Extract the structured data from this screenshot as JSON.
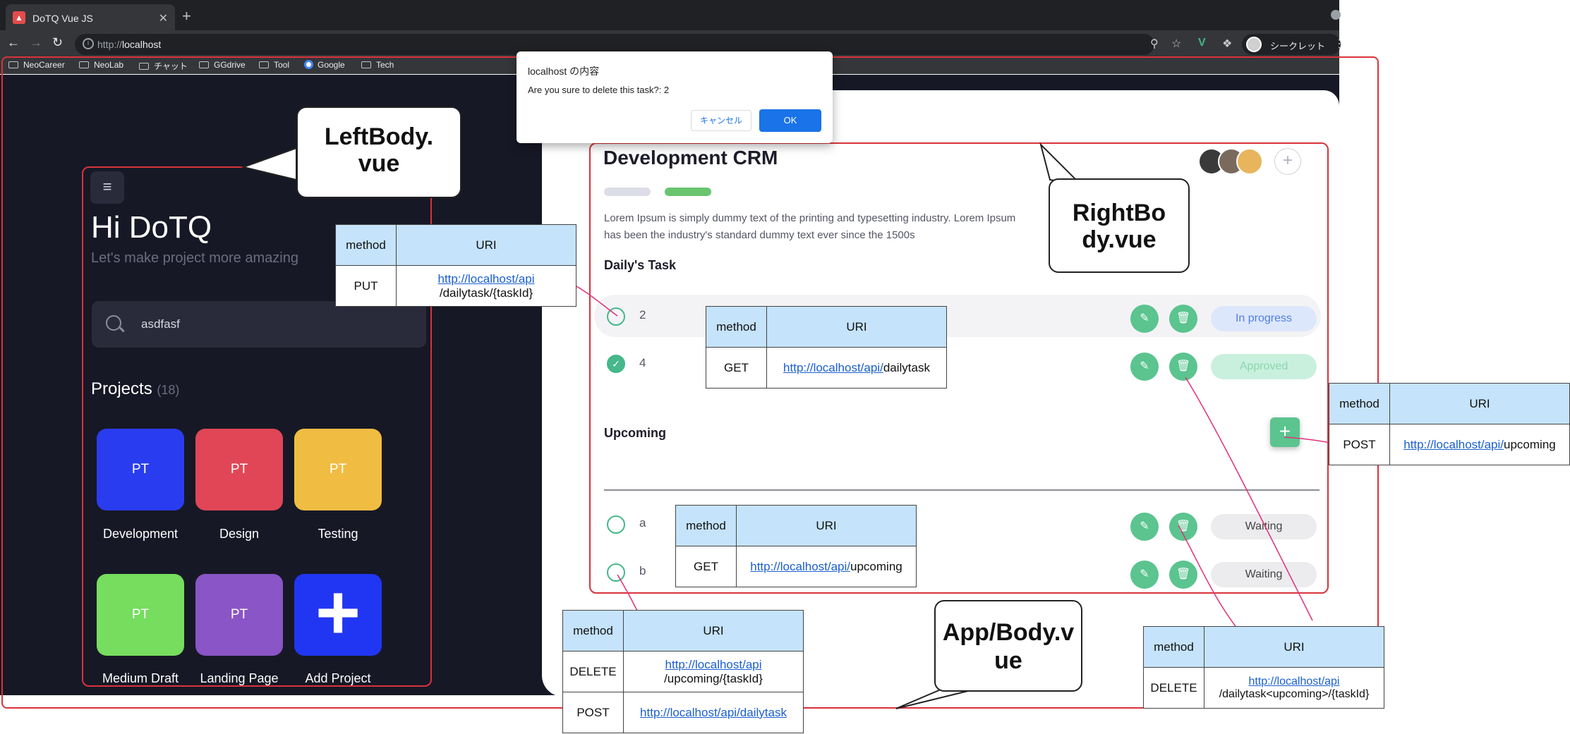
{
  "browser": {
    "tab_title": "DoTQ Vue JS",
    "tab_favicon": "▲",
    "tab_close": "✕",
    "new_tab": "+",
    "url_prefix": "http://",
    "url_host": "localhost",
    "incognito_label": "シークレット",
    "bookmarks": [
      "NeoCareer",
      "NeoLab",
      "チャット",
      "GGdrive",
      "Tool",
      "Google",
      "Tech"
    ]
  },
  "dialog": {
    "title": "localhost の内容",
    "message": "Are you sure to delete this task?: 2",
    "cancel": "キャンセル",
    "ok": "OK"
  },
  "left": {
    "greeting": "Hi DoTQ",
    "subtitle": "Let's make project more amazing",
    "search_value": "asdfasf",
    "projects_title": "Projects",
    "projects_count": "(18)",
    "projects": [
      {
        "abbr": "PT",
        "label": "Development",
        "color": "#2a3cf0"
      },
      {
        "abbr": "PT",
        "label": "Design",
        "color": "#e04656"
      },
      {
        "abbr": "PT",
        "label": "Testing",
        "color": "#f0bc42"
      },
      {
        "abbr": "PT",
        "label": "Medium Draft",
        "color": "#76dd5e"
      },
      {
        "abbr": "PT",
        "label": "Landing Page",
        "color": "#8a55c6"
      },
      {
        "abbr": "+",
        "label": "Add Project",
        "color": "#2136f2"
      }
    ]
  },
  "right": {
    "title": "Development CRM",
    "description": "Lorem Ipsum is simply dummy text of the printing and typesetting industry. Lorem Ipsum has been the industry's standard dummy text ever since the 1500s",
    "daily_title": "Daily's Task",
    "upcoming_title": "Upcoming",
    "daily_tasks": [
      {
        "text": "2",
        "done": false,
        "status": "In progress"
      },
      {
        "text": "4",
        "done": true,
        "status": "Approved"
      }
    ],
    "upcoming_tasks": [
      {
        "text": "a",
        "status": "Waiting"
      },
      {
        "text": "b",
        "status": "Waiting"
      }
    ],
    "colors": {
      "accent": "#5bc48f",
      "inprogress_bg": "#dde7fb",
      "inprogress_fg": "#4f7ee6",
      "approved_bg": "#c9f0dd",
      "approved_fg": "#8cd6b0",
      "waiting_bg": "#ececee",
      "waiting_fg": "#444"
    }
  },
  "annotations": {
    "left_bubble": "LeftBody.vue",
    "right_bubble": "RightBody.vue",
    "app_bubble": "App/Body.vue",
    "col_method": "method",
    "col_uri": "URI",
    "tables": [
      {
        "rows": [
          {
            "method": "PUT",
            "link": "http://localhost/api",
            "rest": "/dailytask/{taskId}"
          }
        ]
      },
      {
        "rows": [
          {
            "method": "GET",
            "link": "http://localhost/api/",
            "rest": "dailytask"
          }
        ]
      },
      {
        "rows": [
          {
            "method": "POST",
            "link": "http://localhost/api/",
            "rest": "upcoming"
          }
        ]
      },
      {
        "rows": [
          {
            "method": "GET",
            "link": "http://localhost/api/",
            "rest": "upcoming"
          }
        ]
      },
      {
        "rows": [
          {
            "method": "DELETE",
            "link": "http://localhost/api",
            "rest": "/upcoming/{taskId}"
          },
          {
            "method": "POST",
            "link": "http://localhost/api/dailytask",
            "rest": ""
          }
        ]
      },
      {
        "rows": [
          {
            "method": "DELETE",
            "link": "http://localhost/api",
            "rest": "/dailytask<upcoming>/{taskId}"
          }
        ]
      }
    ]
  }
}
